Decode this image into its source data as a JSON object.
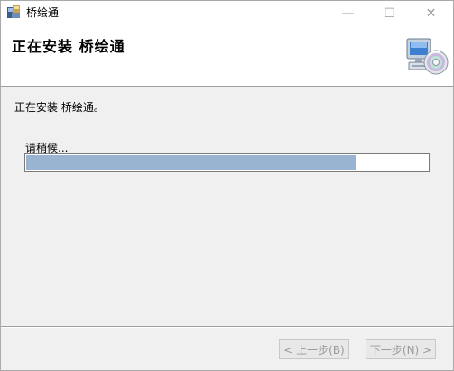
{
  "window": {
    "title": "桥绘通",
    "minimize_glyph": "—",
    "maximize_glyph": "☐",
    "close_glyph": "✕"
  },
  "banner": {
    "heading": "正在安装 桥绘通",
    "icon": "setup-computer-cd-icon"
  },
  "body": {
    "status_line": "正在安装 桥绘通。",
    "wait_label": "请稍候..."
  },
  "progress": {
    "percent": 82,
    "fill_color": "#99b4d1"
  },
  "footer": {
    "back_label": "< 上一步(B)",
    "next_label": "下一步(N) >"
  }
}
